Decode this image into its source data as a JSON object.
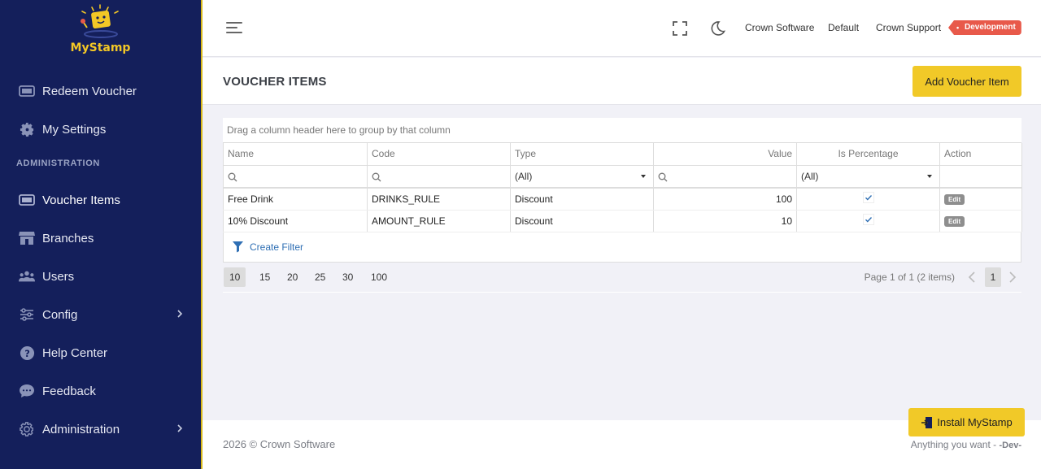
{
  "brand": {
    "name": "MyStamp",
    "accent": "#f1c928",
    "sidebar_bg": "#141f5b"
  },
  "sidebar": {
    "section_title": "ADMINISTRATION",
    "items": [
      {
        "label": "Redeem Voucher",
        "icon": "voucher-icon"
      },
      {
        "label": "My Settings",
        "icon": "gear-icon"
      },
      {
        "label": "Voucher Items",
        "icon": "voucher-icon",
        "active": true
      },
      {
        "label": "Branches",
        "icon": "store-icon"
      },
      {
        "label": "Users",
        "icon": "users-icon"
      },
      {
        "label": "Config",
        "icon": "sliders-icon"
      },
      {
        "label": "Help Center",
        "icon": "question-icon"
      },
      {
        "label": "Feedback",
        "icon": "chat-icon"
      },
      {
        "label": "Administration",
        "icon": "cog-outline-icon"
      }
    ]
  },
  "header": {
    "links": [
      "Crown Software",
      "Default",
      "Crown Support"
    ],
    "env_badge": "Development",
    "env_color": "#e8594a"
  },
  "page": {
    "title": "VOUCHER ITEMS",
    "add_button": "Add Voucher Item"
  },
  "grid": {
    "group_panel_text": "Drag a column header here to group by that column",
    "columns": [
      "Name",
      "Code",
      "Type",
      "Value",
      "Is Percentage",
      "Action"
    ],
    "filters": {
      "type": "(All)",
      "is_percentage": "(All)"
    },
    "rows": [
      {
        "name": "Free Drink",
        "code": "DRINKS_RULE",
        "type": "Discount",
        "value": "100",
        "is_percentage": true,
        "action": "Edit"
      },
      {
        "name": "10% Discount",
        "code": "AMOUNT_RULE",
        "type": "Discount",
        "value": "10",
        "is_percentage": true,
        "action": "Edit"
      }
    ],
    "create_filter": "Create Filter",
    "page_sizes": [
      "10",
      "15",
      "20",
      "25",
      "30",
      "100"
    ],
    "selected_page_size": "10",
    "page_info": "Page 1 of 1 (2 items)",
    "current_page": "1"
  },
  "footer": {
    "copyright": "2026 © Crown Software",
    "tagline": "Anything you want - ",
    "tagline_bold": "-Dev-"
  },
  "install_button": "Install MyStamp"
}
